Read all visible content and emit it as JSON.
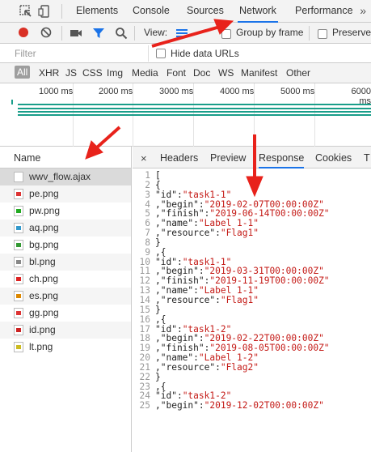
{
  "topbar": {
    "tabs": [
      "Elements",
      "Console",
      "Sources",
      "Network",
      "Performance"
    ],
    "active_tab": "Network",
    "more": "»"
  },
  "toolbar": {
    "view_label": "View:",
    "group_by_frame": "Group by frame",
    "preserve": "Preserve"
  },
  "filter": {
    "placeholder": "Filter",
    "hide_data_urls": "Hide data URLs"
  },
  "types": [
    "All",
    "XHR",
    "JS",
    "CSS",
    "Img",
    "Media",
    "Font",
    "Doc",
    "WS",
    "Manifest",
    "Other"
  ],
  "timeline": {
    "ticks": [
      "1000 ms",
      "2000 ms",
      "3000 ms",
      "4000 ms",
      "5000 ms",
      "6000 ms"
    ]
  },
  "list": {
    "header": "Name",
    "files": [
      {
        "name": "wwv_flow.ajax",
        "icon": "document-icon",
        "color": "#ffffff"
      },
      {
        "name": "pe.png",
        "icon": "image-icon",
        "color": "#d33"
      },
      {
        "name": "pw.png",
        "icon": "image-icon",
        "color": "#2a2"
      },
      {
        "name": "aq.png",
        "icon": "image-icon",
        "color": "#39c"
      },
      {
        "name": "bg.png",
        "icon": "image-icon",
        "color": "#393"
      },
      {
        "name": "bl.png",
        "icon": "image-icon",
        "color": "#888"
      },
      {
        "name": "ch.png",
        "icon": "image-icon",
        "color": "#d22"
      },
      {
        "name": "es.png",
        "icon": "image-icon",
        "color": "#d80"
      },
      {
        "name": "gg.png",
        "icon": "image-icon",
        "color": "#d33"
      },
      {
        "name": "id.png",
        "icon": "image-icon",
        "color": "#c22"
      },
      {
        "name": "lt.png",
        "icon": "image-icon",
        "color": "#cb2"
      }
    ]
  },
  "detail": {
    "close": "×",
    "tabs": [
      "Headers",
      "Preview",
      "Response",
      "Cookies",
      "T"
    ],
    "active_tab": "Response",
    "lines": [
      {
        "n": "1",
        "t": "[",
        "s": ""
      },
      {
        "n": "2",
        "t": "{",
        "s": ""
      },
      {
        "n": "3",
        "t": "\"id\":",
        "s": "\"task1-1\""
      },
      {
        "n": "4",
        "t": ",\"begin\":",
        "s": "\"2019-02-07T00:00:00Z\""
      },
      {
        "n": "5",
        "t": ",\"finish\":",
        "s": "\"2019-06-14T00:00:00Z\""
      },
      {
        "n": "6",
        "t": ",\"name\":",
        "s": "\"Label 1-1\""
      },
      {
        "n": "7",
        "t": ",\"resource\":",
        "s": "\"Flag1\""
      },
      {
        "n": "8",
        "t": "}",
        "s": ""
      },
      {
        "n": "9",
        "t": ",{",
        "s": ""
      },
      {
        "n": "10",
        "t": "\"id\":",
        "s": "\"task1-1\""
      },
      {
        "n": "11",
        "t": ",\"begin\":",
        "s": "\"2019-03-31T00:00:00Z\""
      },
      {
        "n": "12",
        "t": ",\"finish\":",
        "s": "\"2019-11-19T00:00:00Z\""
      },
      {
        "n": "13",
        "t": ",\"name\":",
        "s": "\"Label 1-1\""
      },
      {
        "n": "14",
        "t": ",\"resource\":",
        "s": "\"Flag1\""
      },
      {
        "n": "15",
        "t": "}",
        "s": ""
      },
      {
        "n": "16",
        "t": ",{",
        "s": ""
      },
      {
        "n": "17",
        "t": "\"id\":",
        "s": "\"task1-2\""
      },
      {
        "n": "18",
        "t": ",\"begin\":",
        "s": "\"2019-02-22T00:00:00Z\""
      },
      {
        "n": "19",
        "t": ",\"finish\":",
        "s": "\"2019-08-05T00:00:00Z\""
      },
      {
        "n": "20",
        "t": ",\"name\":",
        "s": "\"Label 1-2\""
      },
      {
        "n": "21",
        "t": ",\"resource\":",
        "s": "\"Flag2\""
      },
      {
        "n": "22",
        "t": "}",
        "s": ""
      },
      {
        "n": "23",
        "t": ",{",
        "s": ""
      },
      {
        "n": "24",
        "t": "\"id\":",
        "s": "\"task1-2\""
      },
      {
        "n": "25",
        "t": ",\"begin\":",
        "s": "\"2019-12-02T00:00:00Z\""
      }
    ]
  },
  "colors": {
    "accent": "#1a73e8",
    "record": "#d93025",
    "annotation": "#e8221b",
    "waterfall": "#1a9e8a"
  }
}
